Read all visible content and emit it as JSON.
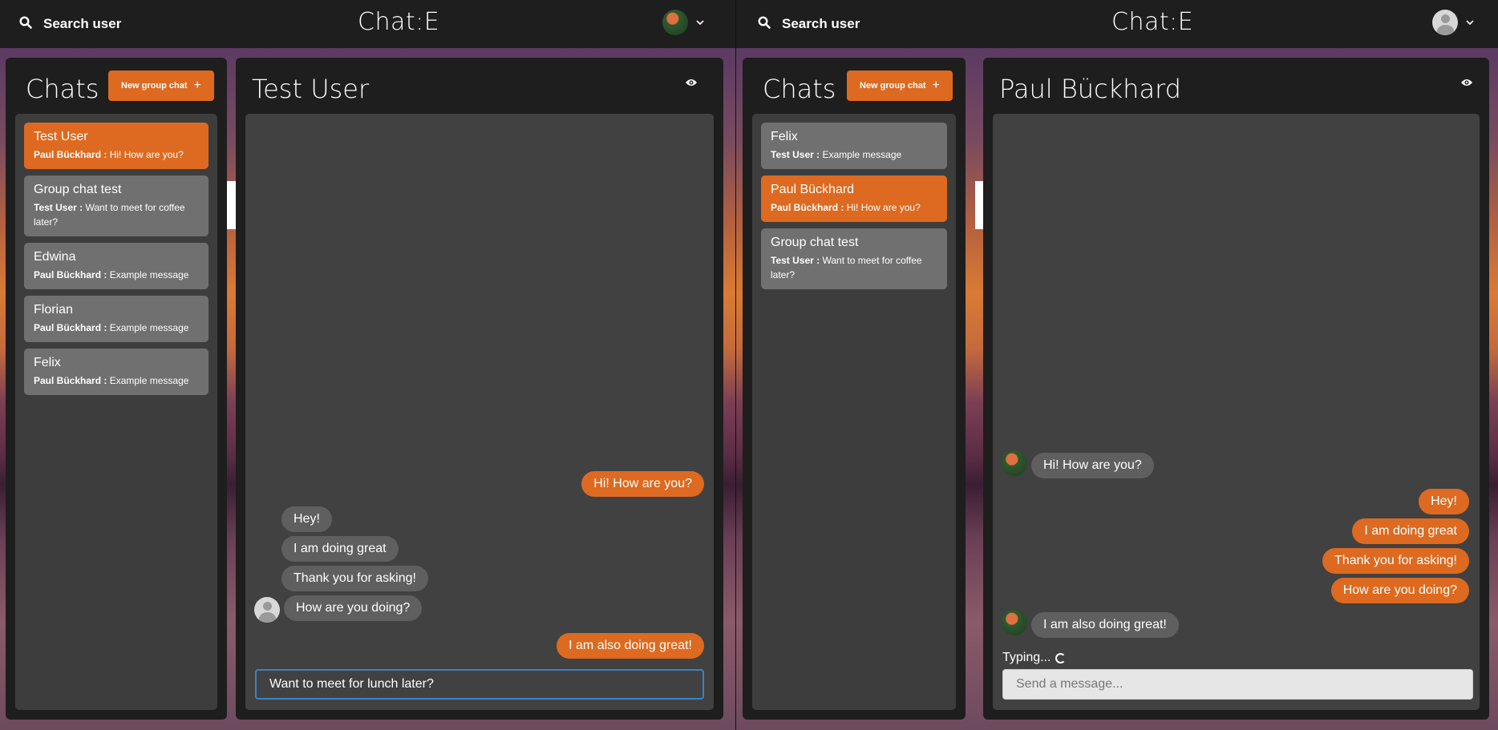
{
  "left": {
    "topbar": {
      "search_label": "Search user",
      "app_title": "Chat:E",
      "avatar": "user-photo"
    },
    "chats_panel": {
      "title": "Chats",
      "new_group_label": "New group chat",
      "items": [
        {
          "name": "Test User",
          "sender": "Paul Bückhard :",
          "message": "Hi! How are you?",
          "active": true
        },
        {
          "name": "Group chat test",
          "sender": "Test User :",
          "message": "Want to meet for coffee later?",
          "active": false
        },
        {
          "name": "Edwina",
          "sender": "Paul Bückhard :",
          "message": "Example message",
          "active": false
        },
        {
          "name": "Florian",
          "sender": "Paul Bückhard :",
          "message": "Example message",
          "active": false
        },
        {
          "name": "Felix",
          "sender": "Paul Bückhard :",
          "message": "Example message",
          "active": false
        }
      ]
    },
    "conversation": {
      "title": "Test User",
      "messages": [
        {
          "text": "Hi! How are you?",
          "mine": true
        },
        {
          "text": "Hey!",
          "mine": false
        },
        {
          "text": "I am doing great",
          "mine": false
        },
        {
          "text": "Thank you for asking!",
          "mine": false
        },
        {
          "text": "How are you doing?",
          "mine": false
        },
        {
          "text": "I am also doing great!",
          "mine": true
        }
      ],
      "input_value": "Want to meet for lunch later?"
    }
  },
  "right": {
    "topbar": {
      "search_label": "Search user",
      "app_title": "Chat:E",
      "avatar": "default-avatar"
    },
    "chats_panel": {
      "title": "Chats",
      "new_group_label": "New group chat",
      "items": [
        {
          "name": "Felix",
          "sender": "Test User :",
          "message": "Example message",
          "active": false
        },
        {
          "name": "Paul Bückhard",
          "sender": "Paul Bückhard :",
          "message": "Hi! How are you?",
          "active": true
        },
        {
          "name": "Group chat test",
          "sender": "Test User :",
          "message": "Want to meet for coffee later?",
          "active": false
        }
      ]
    },
    "conversation": {
      "title": "Paul Bückhard",
      "messages": [
        {
          "text": "Hi! How are you?",
          "mine": false
        },
        {
          "text": "Hey!",
          "mine": true
        },
        {
          "text": "I am doing great",
          "mine": true
        },
        {
          "text": "Thank you for asking!",
          "mine": true
        },
        {
          "text": "How are you doing?",
          "mine": true
        },
        {
          "text": "I am also doing great!",
          "mine": false
        }
      ],
      "typing_label": "Typing...",
      "input_placeholder": "Send a message..."
    }
  },
  "colors": {
    "accent": "#dd6a20",
    "panel": "#1e1e1e",
    "box": "#414141",
    "bubble_other": "#5f5f5f",
    "item": "#707070"
  }
}
